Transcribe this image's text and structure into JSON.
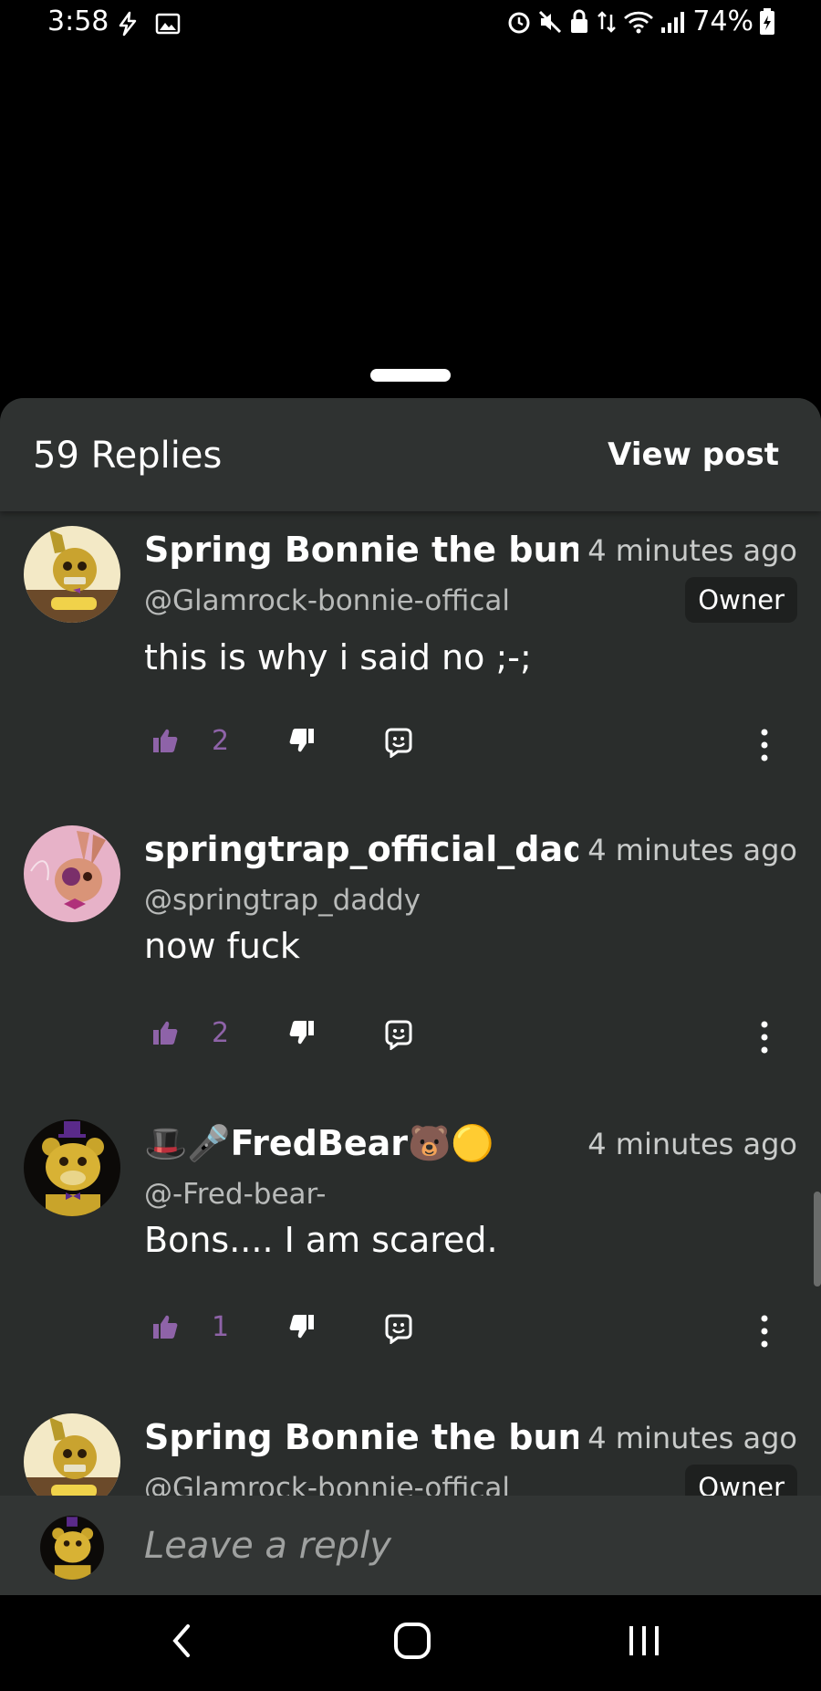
{
  "status_bar": {
    "time": "3:58",
    "battery": "74%",
    "icons": [
      "flash-icon",
      "image-icon",
      "alarm-icon",
      "mute-icon",
      "vpn-icon",
      "data-arrows-icon",
      "wifi-icon",
      "signal-icon",
      "battery-icon"
    ]
  },
  "header": {
    "replies_count": "59 Replies",
    "view_post_label": "View post"
  },
  "comments": [
    {
      "author": "Spring Bonnie the bunny",
      "handle": "@Glamrock-bonnie-offical",
      "time": "4 minutes ago",
      "badge": "Owner",
      "text": "this is why i said no ;-;",
      "likes": "2"
    },
    {
      "author": "springtrap_official_daddy",
      "handle": "@springtrap_daddy",
      "time": "4 minutes ago",
      "text": "now fuck",
      "likes": "2"
    },
    {
      "author": "🎩🎤FredBear🐻🟡",
      "handle": "@-Fred-bear-",
      "time": "4 minutes ago",
      "text": "Bons.... I am scared.",
      "likes": "1"
    },
    {
      "author": "Spring Bonnie the bunny",
      "handle": "@Glamrock-bonnie-offical",
      "time": "4 minutes ago",
      "badge": "Owner"
    }
  ],
  "reply_bar": {
    "placeholder": "Leave a reply"
  },
  "colors": {
    "accent": "#8e63a8",
    "sheet_bg": "#2a2d2c",
    "header_bg": "#2f3231",
    "badge_bg": "#1e201f"
  }
}
